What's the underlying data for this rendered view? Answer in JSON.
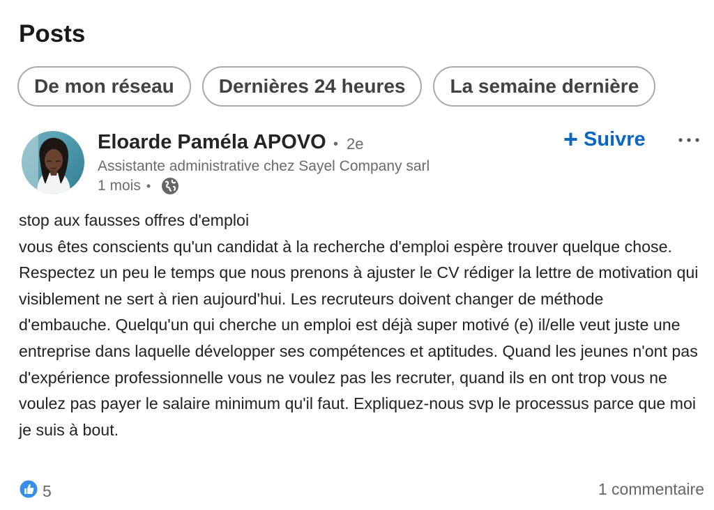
{
  "section": {
    "title": "Posts"
  },
  "filters": [
    {
      "label": "De mon réseau"
    },
    {
      "label": "Dernières 24 heures"
    },
    {
      "label": "La semaine dernière"
    }
  ],
  "post": {
    "author": {
      "name": "Eloarde Paméla APOVO",
      "degree_separator": "•",
      "degree": "2e",
      "headline": "Assistante administrative chez Sayel Company sarl",
      "age": "1 mois",
      "meta_separator": "•",
      "visibility_icon": "globe-icon"
    },
    "follow_label": "Suivre",
    "follow_icon": "plus-icon",
    "more_icon": "more-horizontal-icon",
    "body": "stop aux fausses offres d'emploi\nvous êtes conscients qu'un candidat à la recherche d'emploi espère trouver quelque chose. Respectez un peu le temps que nous prenons à ajuster le CV rédiger la lettre de motivation qui visiblement ne sert à rien aujourd'hui. Les recruteurs doivent changer de méthode d'embauche. Quelqu'un qui cherche un emploi est déjà super motivé (e) il/elle veut juste une entreprise dans laquelle développer ses compétences et aptitudes. Quand les jeunes n'ont pas d'expérience professionnelle vous ne voulez pas les recruter, quand ils en ont trop vous ne voulez pas payer le salaire minimum qu'il faut. Expliquez-nous svp le processus parce que moi je suis à bout.",
    "reactions": {
      "icon": "like-icon",
      "count": "5"
    },
    "comments": "1 commentaire"
  },
  "colors": {
    "accent": "#0a66c2",
    "like": "#378fe9",
    "muted_text": "#6b6b6b",
    "pill_border": "#a9a9a9"
  }
}
